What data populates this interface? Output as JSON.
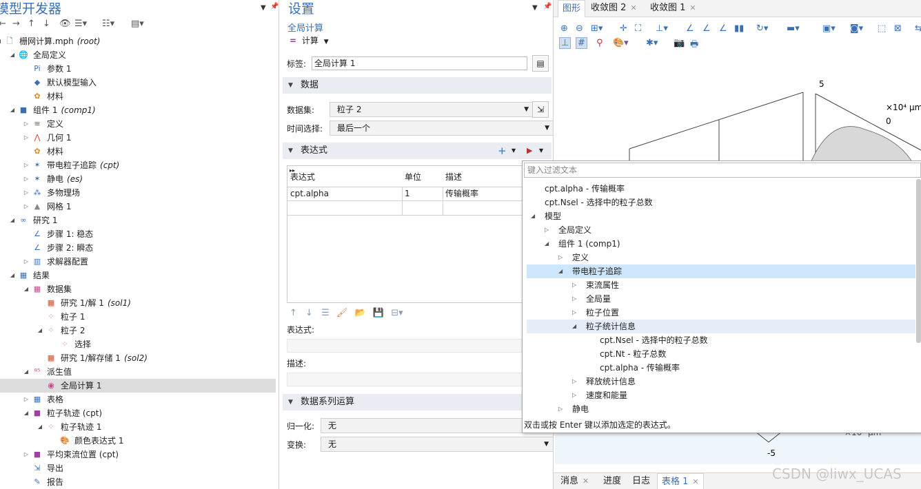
{
  "model_builder": {
    "title": "模型开发器",
    "tree": [
      {
        "label": "栅网计算.mph",
        "tag": "(root)",
        "level": 0
      },
      {
        "label": "全局定义",
        "level": 1
      },
      {
        "label": "参数 1",
        "level": 2
      },
      {
        "label": "默认模型输入",
        "level": 2
      },
      {
        "label": "材料",
        "level": 2
      },
      {
        "label": "组件 1",
        "tag": "(comp1)",
        "level": 1
      },
      {
        "label": "定义",
        "level": 2
      },
      {
        "label": "几何 1",
        "level": 2
      },
      {
        "label": "材料",
        "level": 2
      },
      {
        "label": "带电粒子追踪",
        "tag": "(cpt)",
        "level": 2
      },
      {
        "label": "静电",
        "tag": "(es)",
        "level": 2
      },
      {
        "label": "多物理场",
        "level": 2
      },
      {
        "label": "网格 1",
        "level": 2
      },
      {
        "label": "研究 1",
        "level": 1
      },
      {
        "label": "步骤 1: 稳态",
        "level": 2
      },
      {
        "label": "步骤 2: 瞬态",
        "level": 2
      },
      {
        "label": "求解器配置",
        "level": 2
      },
      {
        "label": "结果",
        "level": 1
      },
      {
        "label": "数据集",
        "level": 2
      },
      {
        "label": "研究 1/解 1",
        "tag": "(sol1)",
        "level": 3
      },
      {
        "label": "粒子 1",
        "level": 3
      },
      {
        "label": "粒子 2",
        "level": 3
      },
      {
        "label": "选择",
        "level": 4
      },
      {
        "label": "研究 1/解存储 1",
        "tag": "(sol2)",
        "level": 3
      },
      {
        "label": "派生值",
        "level": 2
      },
      {
        "label": "全局计算 1",
        "level": 3
      },
      {
        "label": "表格",
        "level": 2
      },
      {
        "label": "粒子轨迹 (cpt)",
        "level": 2
      },
      {
        "label": "粒子轨迹 1",
        "level": 3
      },
      {
        "label": "颜色表达式 1",
        "level": 4
      },
      {
        "label": "平均束流位置 (cpt)",
        "level": 2
      },
      {
        "label": "导出",
        "level": 2
      },
      {
        "label": "报告",
        "level": 2
      }
    ]
  },
  "settings": {
    "title": "设置",
    "subtitle": "全局计算",
    "compute_label": "计算",
    "label_field": {
      "label": "标签:",
      "value": "全局计算 1"
    },
    "data_section": "数据",
    "dataset": {
      "label": "数据集:",
      "value": "粒子 2"
    },
    "time_select": {
      "label": "时间选择:",
      "value": "最后一个"
    },
    "expr_section": "表达式",
    "table": {
      "headers": [
        "表达式",
        "单位",
        "描述"
      ],
      "rows": [
        [
          "cpt.alpha",
          "1",
          "传输概率"
        ]
      ]
    },
    "expression_label": "表达式:",
    "description_label": "描述:",
    "series_section": "数据系列运算",
    "normalize": {
      "label": "归一化:",
      "value": "无"
    },
    "transform": {
      "label": "变换:",
      "value": "无"
    }
  },
  "graphics": {
    "tabs": [
      "图形",
      "收敛图 2",
      "收敛图 1"
    ],
    "bottom_tabs": [
      "消息",
      "进度",
      "日志",
      "表格 1"
    ],
    "axis_labels": [
      "5",
      "×10⁴ µm",
      "0",
      "-5",
      "×10⁴ µm"
    ]
  },
  "popup": {
    "filter_placeholder": "键入过滤文本",
    "items": [
      {
        "text": "cpt.alpha - 传输概率",
        "indent": 0,
        "toggle": ""
      },
      {
        "text": "cpt.Nsel - 选择中的粒子总数",
        "indent": 0,
        "toggle": ""
      },
      {
        "text": "模型",
        "indent": 0,
        "toggle": "open"
      },
      {
        "text": "全局定义",
        "indent": 1,
        "toggle": "closed"
      },
      {
        "text": "组件 1 (comp1)",
        "indent": 1,
        "toggle": "open"
      },
      {
        "text": "定义",
        "indent": 2,
        "toggle": "closed"
      },
      {
        "text": "带电粒子追踪",
        "indent": 2,
        "toggle": "open",
        "highlight": "strong"
      },
      {
        "text": "束流属性",
        "indent": 3,
        "toggle": "closed"
      },
      {
        "text": "全局量",
        "indent": 3,
        "toggle": "closed"
      },
      {
        "text": "粒子位置",
        "indent": 3,
        "toggle": "closed"
      },
      {
        "text": "粒子统计信息",
        "indent": 3,
        "toggle": "open",
        "highlight": "light"
      },
      {
        "text": "cpt.Nsel - 选择中的粒子总数",
        "indent": 4,
        "toggle": ""
      },
      {
        "text": "cpt.Nt - 粒子总数",
        "indent": 4,
        "toggle": ""
      },
      {
        "text": "cpt.alpha - 传输概率",
        "indent": 4,
        "toggle": ""
      },
      {
        "text": "释放统计信息",
        "indent": 3,
        "toggle": "closed"
      },
      {
        "text": "速度和能量",
        "indent": 3,
        "toggle": "closed"
      },
      {
        "text": "静电",
        "indent": 2,
        "toggle": "closed"
      }
    ],
    "footer": "双击或按 Enter 键以添加选定的表达式。"
  },
  "watermark": "CSDN @liwx_UCAS",
  "colors": {
    "accent": "#3a6fb5",
    "selected_row": "#dcdcdc",
    "popup_highlight": "#cde6fb"
  }
}
